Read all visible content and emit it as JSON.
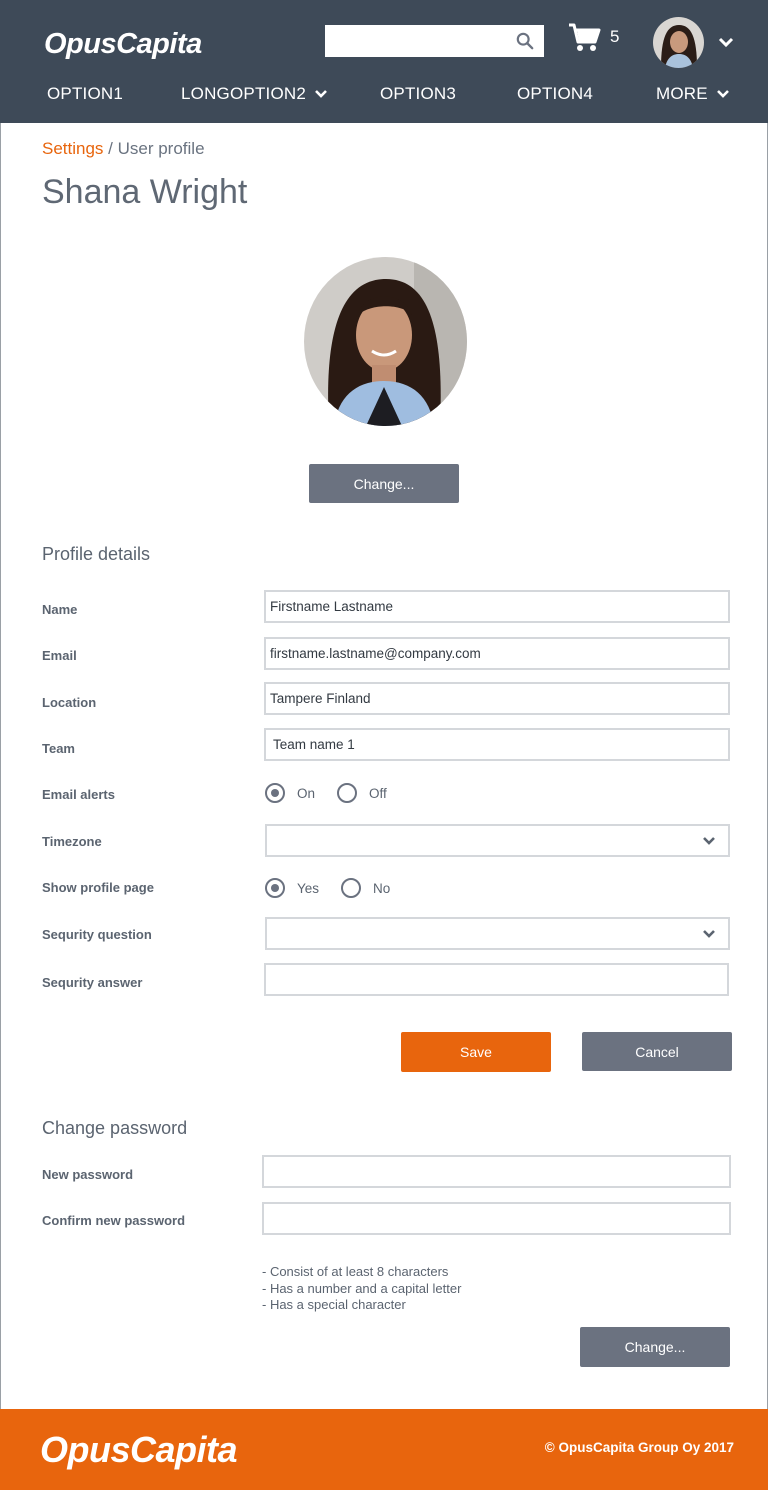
{
  "header": {
    "logo": "OpusCapita",
    "search": {
      "value": "",
      "placeholder": ""
    },
    "cart_count": "5",
    "nav": [
      {
        "label": "OPTION1",
        "has_chevron": false
      },
      {
        "label": "LONGOPTION2",
        "has_chevron": true
      },
      {
        "label": "OPTION3",
        "has_chevron": false
      },
      {
        "label": "OPTION4",
        "has_chevron": false
      },
      {
        "label": "MORE",
        "has_chevron": true
      }
    ]
  },
  "breadcrumb": {
    "link": "Settings",
    "separator": " / ",
    "current": "User profile"
  },
  "page_title": "Shana Wright",
  "profile_picture": {
    "change_label": "Change..."
  },
  "profile_details": {
    "title": "Profile details",
    "name": {
      "label": "Name",
      "value": "Firstname Lastname"
    },
    "email": {
      "label": "Email",
      "value": "firstname.lastname@company.com"
    },
    "location": {
      "label": "Location",
      "value": "Tampere Finland"
    },
    "team": {
      "label": "Team",
      "value": "Team name 1"
    },
    "email_alerts": {
      "label": "Email alerts",
      "options": [
        "On",
        "Off"
      ],
      "selected": "On"
    },
    "timezone": {
      "label": "Timezone",
      "value": ""
    },
    "show_profile": {
      "label": "Show profile page",
      "options": [
        "Yes",
        "No"
      ],
      "selected": "Yes"
    },
    "security_question": {
      "label": "Sequrity question",
      "value": ""
    },
    "security_answer": {
      "label": "Sequrity answer",
      "value": ""
    },
    "save_label": "Save",
    "cancel_label": "Cancel"
  },
  "change_password": {
    "title": "Change password",
    "new_password_label": "New password",
    "confirm_password_label": "Confirm new password",
    "rules": [
      "- Consist of at least 8 characters",
      "- Has a number and a capital letter",
      "- Has a special character"
    ],
    "change_label": "Change..."
  },
  "footer": {
    "logo": "OpusCapita",
    "copyright": "© OpusCapita Group Oy 2017"
  },
  "colors": {
    "header_bg": "#3e4a58",
    "accent": "#e8650d",
    "button_gray": "#6b7280"
  }
}
